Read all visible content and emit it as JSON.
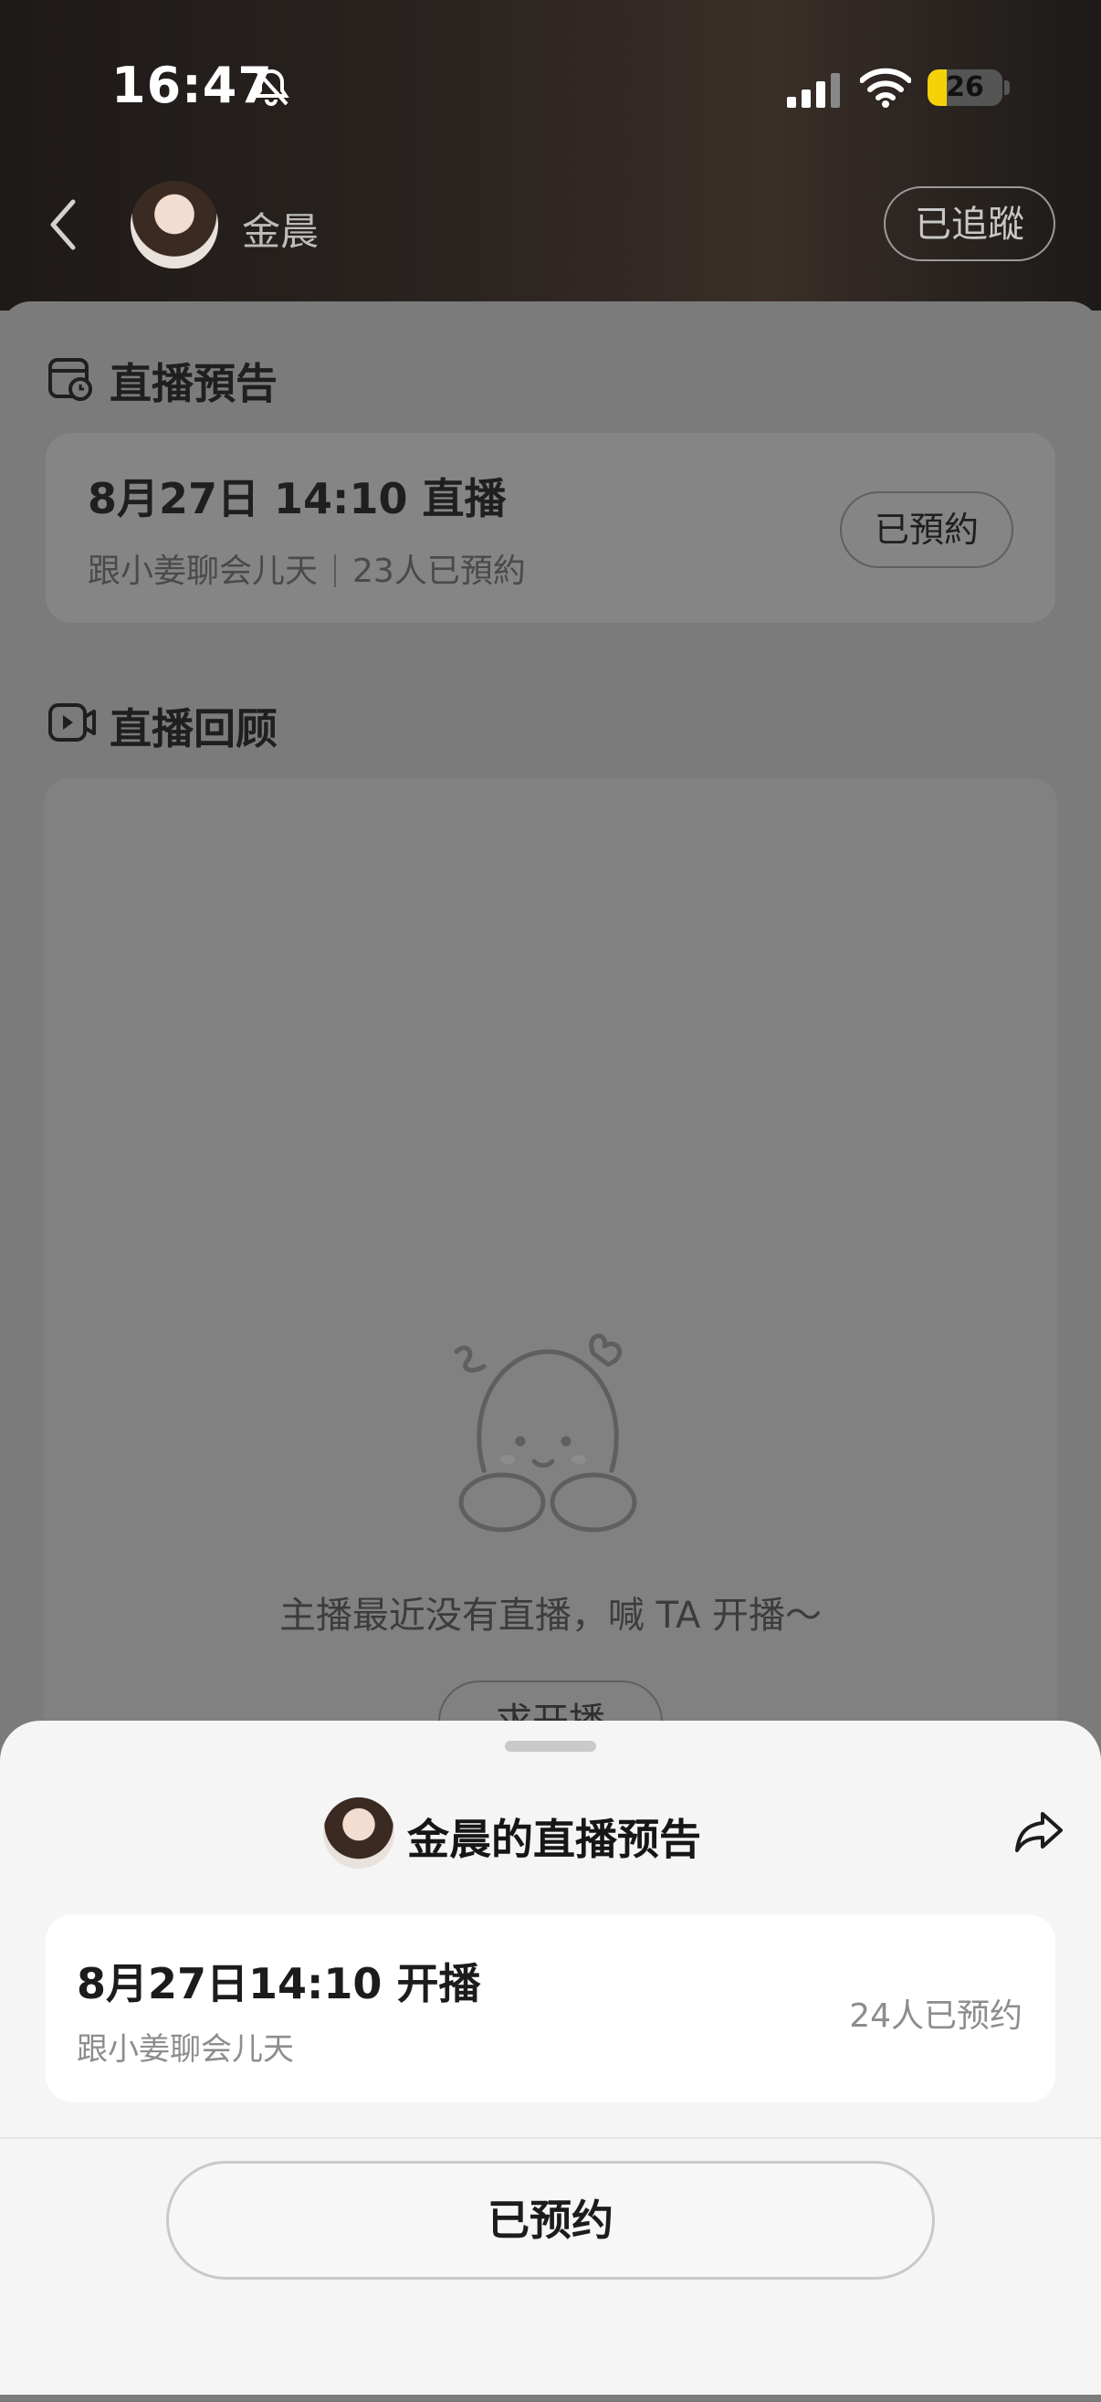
{
  "status_bar": {
    "time": "16:47",
    "battery": "26",
    "battery_level": 0.26
  },
  "header": {
    "name": "金晨",
    "follow_label": "已追蹤"
  },
  "preview_section": {
    "title": "直播預告",
    "date": "8月27日 14:10 直播",
    "topic": "跟小姜聊会儿天",
    "count": "23人已預約",
    "button_label": "已預約"
  },
  "replay_section": {
    "title": "直播回顾",
    "empty_text": "主播最近没有直播，喊 TA 开播～",
    "ask_label": "求开播"
  },
  "sheet": {
    "title": "金晨的直播预告",
    "date": "8月27日14:10 开播",
    "topic": "跟小姜聊会儿天",
    "count": "24人已预约",
    "button_label": "已预约"
  },
  "icons": {
    "back": "chevron-left-icon",
    "bell": "bell-slash-icon",
    "signal": "signal-icon",
    "wifi": "wifi-icon",
    "calendar": "calendar-clock-icon",
    "video": "video-play-icon",
    "share": "share-icon"
  },
  "colors": {
    "battery": "#f5d10a"
  }
}
